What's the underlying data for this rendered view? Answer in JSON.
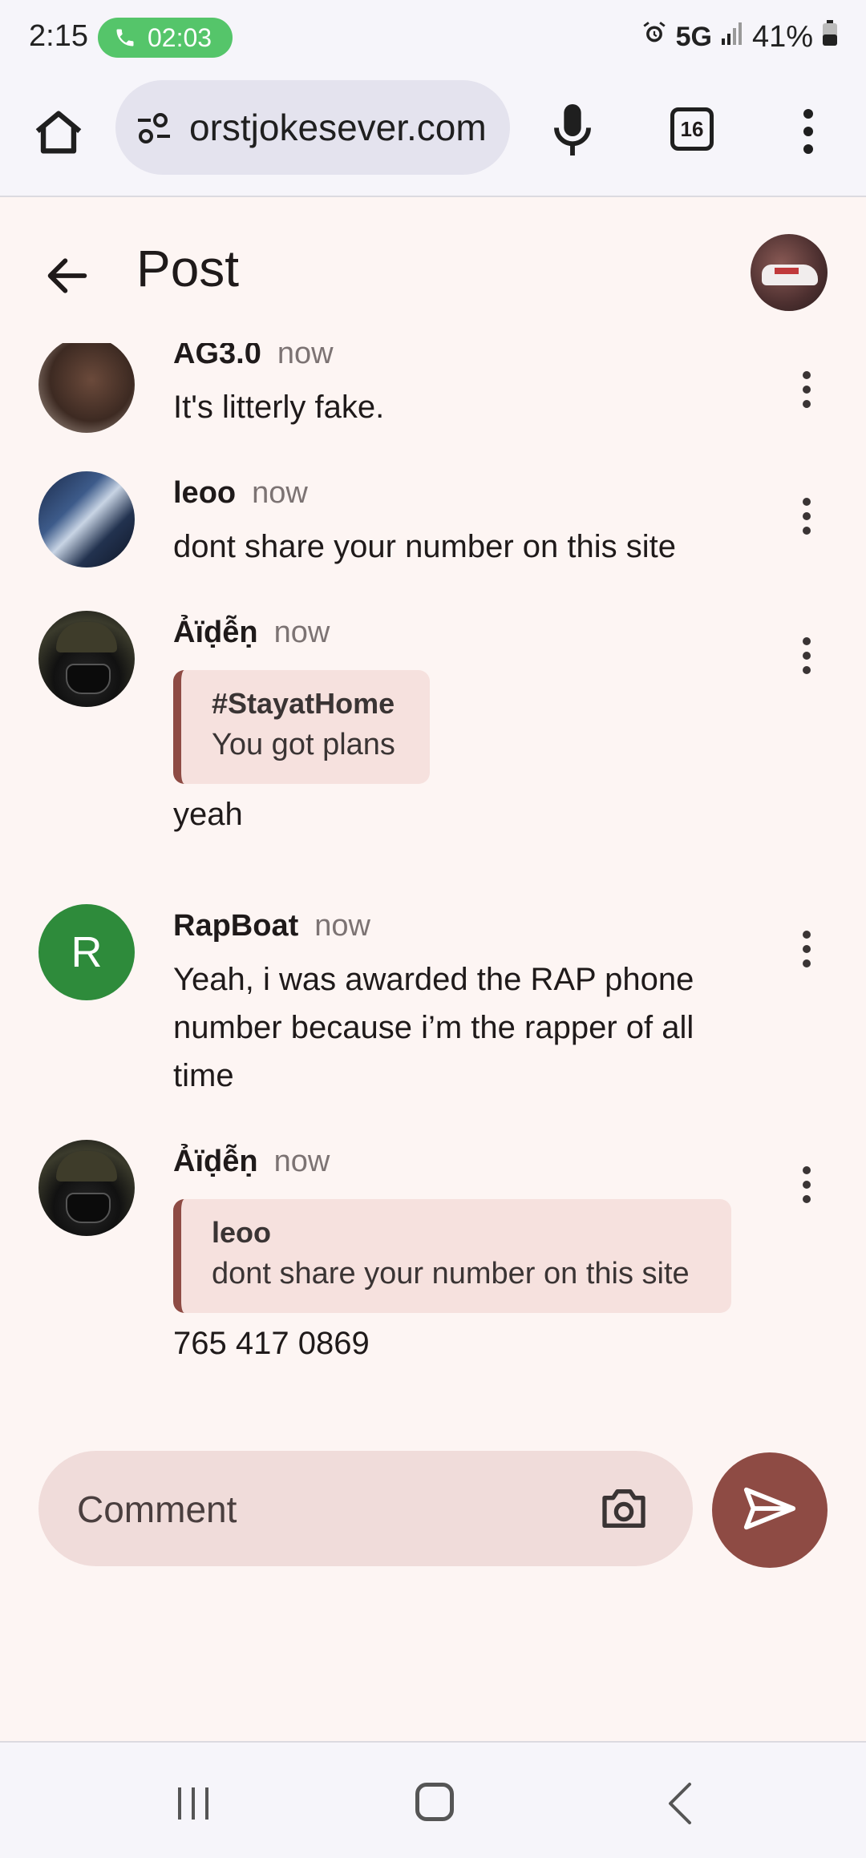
{
  "status_bar": {
    "time": "2:15",
    "call_timer": "02:03",
    "network": "5G",
    "battery": "41%"
  },
  "browser": {
    "url": "orstjokesever.com",
    "tab_count": "16"
  },
  "header": {
    "title": "Post"
  },
  "comments": [
    {
      "name": "AG3.0",
      "time": "now",
      "text": "It's litterly fake."
    },
    {
      "name": "leoo",
      "time": "now",
      "text": "dont share your number on this site"
    },
    {
      "name": "Ảïḍễṇ",
      "time": "now",
      "quote": {
        "title": "#StayatHome",
        "text": "You got plans"
      },
      "text": "yeah"
    },
    {
      "name": "RapBoat",
      "time": "now",
      "avatar_letter": "R",
      "text": "Yeah, i was awarded the RAP phone number because i’m the rapper of all time"
    },
    {
      "name": "Ảïḍễṇ",
      "time": "now",
      "quote": {
        "title": "leoo",
        "text": "dont share your number on this site"
      },
      "text": "765 417 0869"
    }
  ],
  "composer": {
    "placeholder": "Comment"
  },
  "colors": {
    "accent": "#8e4b44",
    "background": "#fdf5f3",
    "input_bg": "#f0dcda",
    "call_green": "#55c56a",
    "avatar_green": "#2e8b3b"
  },
  "icons": [
    "phone-icon",
    "alarm-icon",
    "signal-icon",
    "battery-icon",
    "home-icon",
    "tune-icon",
    "mic-icon",
    "more-vert-icon",
    "back-arrow-icon",
    "camera-icon",
    "send-icon",
    "recents-icon",
    "nav-home-icon",
    "nav-back-icon"
  ]
}
